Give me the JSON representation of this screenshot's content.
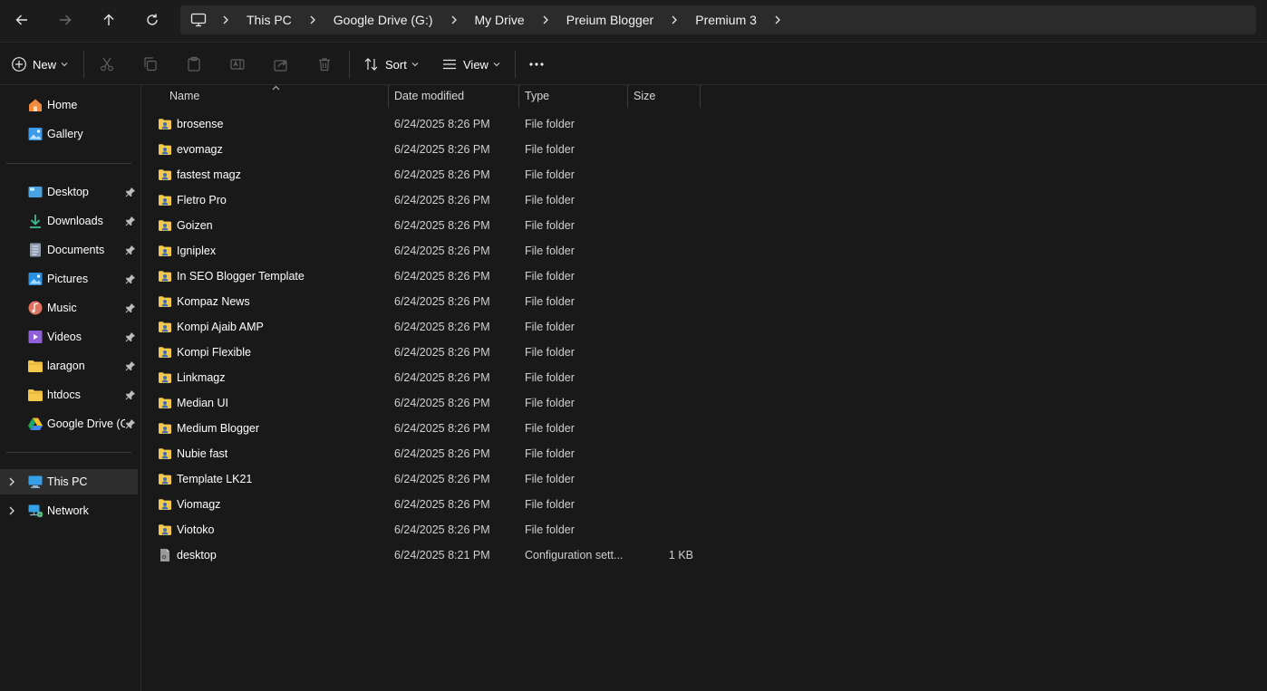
{
  "colors": {
    "background": "#191919",
    "bar": "#2b2b2b",
    "folder": "#f5c84c",
    "text": "#ffffff",
    "secondary_text": "#cfcfcf"
  },
  "nav_buttons": [
    {
      "name": "back-button",
      "icon": "arrow-left-icon"
    },
    {
      "name": "forward-button",
      "icon": "arrow-right-icon"
    },
    {
      "name": "up-button",
      "icon": "arrow-up-icon"
    },
    {
      "name": "refresh-button",
      "icon": "refresh-icon"
    }
  ],
  "breadcrumb": [
    "This PC",
    "Google Drive (G:)",
    "My Drive",
    "Preium Blogger",
    "Premium 3"
  ],
  "toolbar": {
    "new_label": "New",
    "sort_label": "Sort",
    "view_label": "View",
    "icons": [
      "cut-icon",
      "copy-icon",
      "paste-icon",
      "rename-icon",
      "share-icon",
      "delete-icon",
      "more-icon"
    ]
  },
  "sidebar": {
    "top": [
      {
        "label": "Home",
        "icon": "home-icon"
      },
      {
        "label": "Gallery",
        "icon": "gallery-icon"
      }
    ],
    "quick_access": [
      {
        "label": "Desktop",
        "icon": "desktop-icon",
        "pinned": true
      },
      {
        "label": "Downloads",
        "icon": "download-icon",
        "pinned": true
      },
      {
        "label": "Documents",
        "icon": "documents-icon",
        "pinned": true
      },
      {
        "label": "Pictures",
        "icon": "pictures-icon",
        "pinned": true
      },
      {
        "label": "Music",
        "icon": "music-icon",
        "pinned": true
      },
      {
        "label": "Videos",
        "icon": "videos-icon",
        "pinned": true
      },
      {
        "label": "laragon",
        "icon": "folder-icon",
        "pinned": true
      },
      {
        "label": "htdocs",
        "icon": "folder-icon",
        "pinned": true
      },
      {
        "label": "Google Drive (G:)",
        "icon": "google-drive-icon",
        "pinned": true
      }
    ],
    "drives": [
      {
        "label": "This PC",
        "icon": "this-pc-icon",
        "selected": true
      },
      {
        "label": "Network",
        "icon": "network-icon",
        "selected": false
      }
    ]
  },
  "columns": {
    "name": "Name",
    "date": "Date modified",
    "type": "Type",
    "size": "Size"
  },
  "files": [
    {
      "name": "brosense",
      "date": "6/24/2025 8:26 PM",
      "type": "File folder",
      "size": ""
    },
    {
      "name": "evomagz",
      "date": "6/24/2025 8:26 PM",
      "type": "File folder",
      "size": ""
    },
    {
      "name": "fastest magz",
      "date": "6/24/2025 8:26 PM",
      "type": "File folder",
      "size": ""
    },
    {
      "name": "Fletro Pro",
      "date": "6/24/2025 8:26 PM",
      "type": "File folder",
      "size": ""
    },
    {
      "name": "Goizen",
      "date": "6/24/2025 8:26 PM",
      "type": "File folder",
      "size": ""
    },
    {
      "name": "Igniplex",
      "date": "6/24/2025 8:26 PM",
      "type": "File folder",
      "size": ""
    },
    {
      "name": "In SEO Blogger Template",
      "date": "6/24/2025 8:26 PM",
      "type": "File folder",
      "size": ""
    },
    {
      "name": "Kompaz News",
      "date": "6/24/2025 8:26 PM",
      "type": "File folder",
      "size": ""
    },
    {
      "name": "Kompi Ajaib AMP",
      "date": "6/24/2025 8:26 PM",
      "type": "File folder",
      "size": ""
    },
    {
      "name": "Kompi Flexible",
      "date": "6/24/2025 8:26 PM",
      "type": "File folder",
      "size": ""
    },
    {
      "name": "Linkmagz",
      "date": "6/24/2025 8:26 PM",
      "type": "File folder",
      "size": ""
    },
    {
      "name": "Median UI",
      "date": "6/24/2025 8:26 PM",
      "type": "File folder",
      "size": ""
    },
    {
      "name": "Medium Blogger",
      "date": "6/24/2025 8:26 PM",
      "type": "File folder",
      "size": ""
    },
    {
      "name": "Nubie fast",
      "date": "6/24/2025 8:26 PM",
      "type": "File folder",
      "size": ""
    },
    {
      "name": "Template LK21",
      "date": "6/24/2025 8:26 PM",
      "type": "File folder",
      "size": ""
    },
    {
      "name": "Viomagz",
      "date": "6/24/2025 8:26 PM",
      "type": "File folder",
      "size": ""
    },
    {
      "name": "Viotoko",
      "date": "6/24/2025 8:26 PM",
      "type": "File folder",
      "size": ""
    },
    {
      "name": "desktop",
      "date": "6/24/2025 8:21 PM",
      "type": "Configuration sett...",
      "size": "1 KB"
    }
  ]
}
